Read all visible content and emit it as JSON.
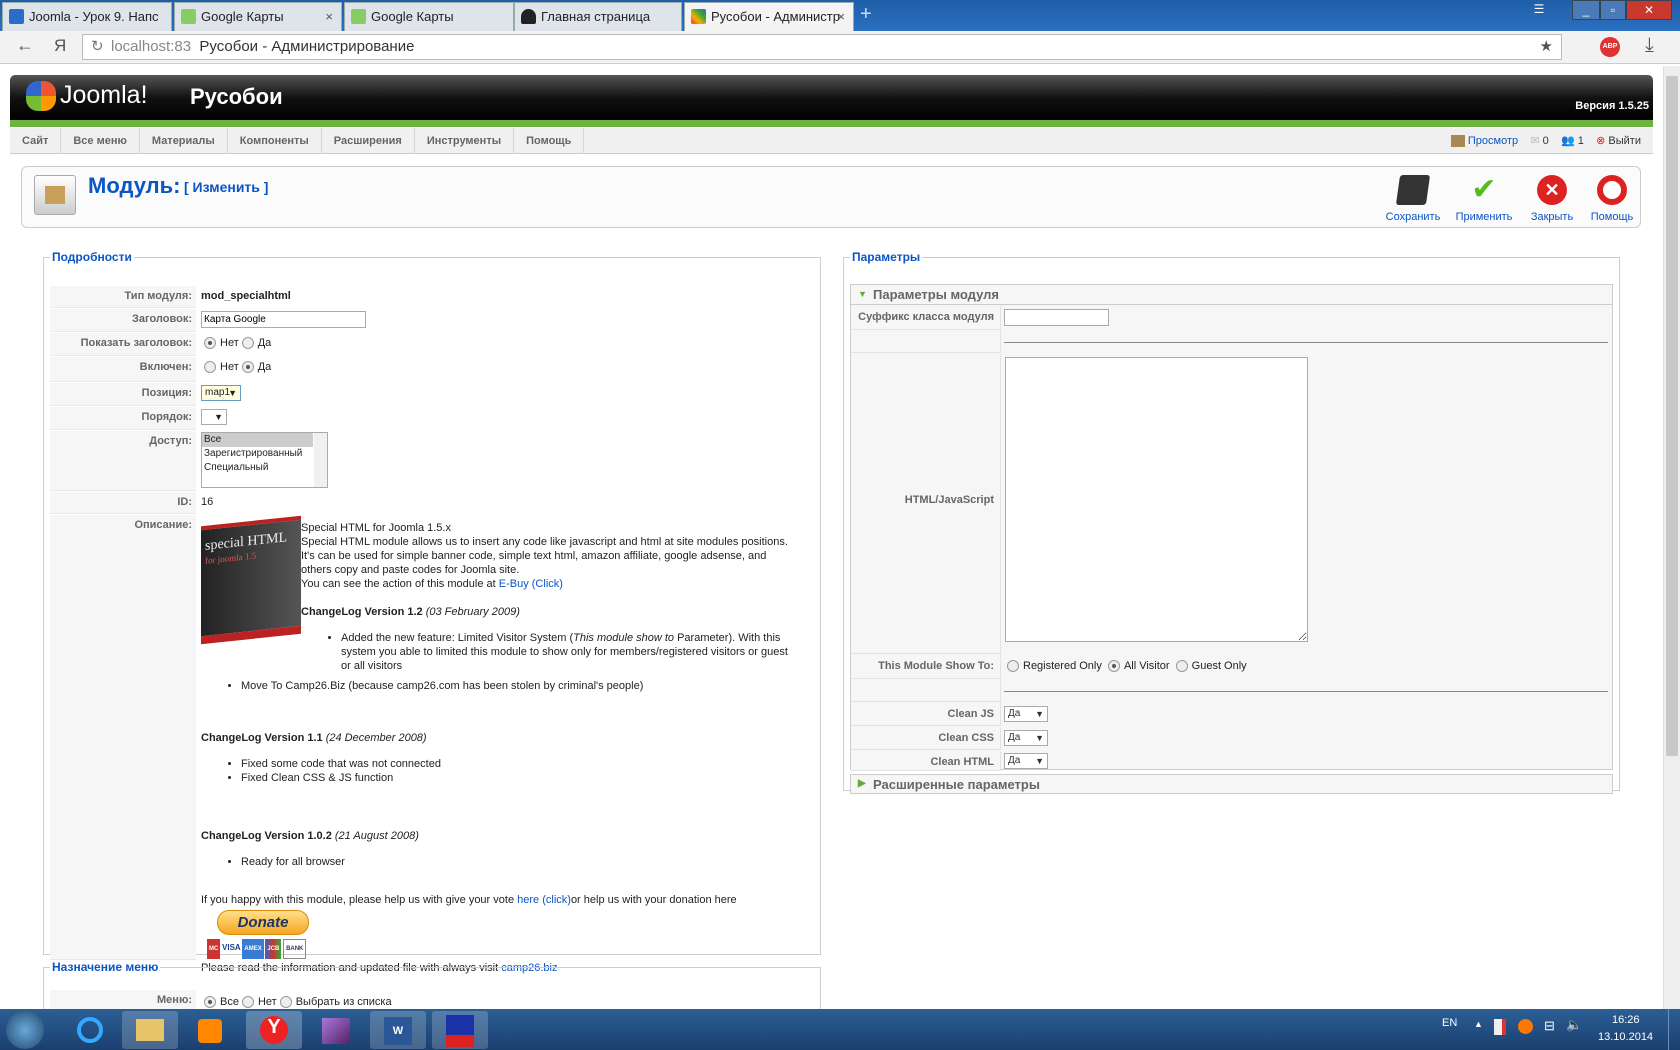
{
  "browser": {
    "tabs": [
      {
        "title": "Joomla - Урок 9. Напс",
        "icon": "site-icon"
      },
      {
        "title": "Google Карты",
        "icon": "maps-icon"
      },
      {
        "title": "Google Карты",
        "icon": "maps-icon"
      },
      {
        "title": "Главная страница",
        "icon": "spy-icon"
      },
      {
        "title": "Русобои - Администр",
        "icon": "joomla-icon"
      }
    ],
    "close": "×",
    "new_tab": "+",
    "back": "←",
    "yandex": "Я",
    "reload": "↻",
    "url_host": "localhost:83",
    "url_title": "Русобои - Администрирование",
    "star": "★",
    "abp": "ABP",
    "download": "⤓"
  },
  "header": {
    "logo": "Joomla!",
    "site": "Русобои",
    "version": "Версия 1.5.25"
  },
  "menu": [
    "Сайт",
    "Все меню",
    "Материалы",
    "Компоненты",
    "Расширения",
    "Инструменты",
    "Помощь"
  ],
  "status": {
    "preview": "Просмотр",
    "messages": "0",
    "users": "1",
    "logout": "Выйти"
  },
  "page": {
    "title": "Модуль:",
    "subtitle": "[ Изменить ]"
  },
  "toolbar": {
    "save": "Сохранить",
    "apply": "Применить",
    "close": "Закрыть",
    "help": "Помощь"
  },
  "details": {
    "legend": "Подробности",
    "type_label": "Тип модуля:",
    "type_value": "mod_specialhtml",
    "title_label": "Заголовок:",
    "title_value": "Карта Google",
    "show_title_label": "Показать заголовок:",
    "no": "Нет",
    "yes": "Да",
    "enabled_label": "Включен:",
    "position_label": "Позиция:",
    "position_value": "map1",
    "order_label": "Порядок:",
    "access_label": "Доступ:",
    "access_options": [
      "Все",
      "Зарегистрированный",
      "Специальный"
    ],
    "id_label": "ID:",
    "id_value": "16",
    "desc_label": "Описание:"
  },
  "description": {
    "box_text": "special HTML",
    "box_sub": "for joomla 1.5",
    "l1": "Special HTML for Joomla 1.5.x",
    "l2": "Special HTML module allows us to insert any code like javascript and html at site modules positions. It's can be used for simple banner code, simple text html, amazon affiliate, google adsense, and others copy and paste codes for Joomla site.",
    "l3": "You can see the action of this module at ",
    "ebuy": "E-Buy",
    "click": "(Click)",
    "v12": "ChangeLog Version 1.2",
    "v12_date": "(03 February 2009)",
    "v12_a1": "Added the new feature: Limited Visitor System (",
    "v12_a2": "This module show to",
    "v12_a3": " Parameter). With this system you able to limited this module to show only for members/registered visitors or guest or all visitors",
    "v12_b": "Move To Camp26.Biz (because camp26.com has been stolen by criminal's people)",
    "v11": "ChangeLog Version 1.1",
    "v11_date": "(24 December 2008)",
    "v11_a": "Fixed some code that was not connected",
    "v11_b": "Fixed Clean CSS & JS function",
    "v102": "ChangeLog Version 1.0.2",
    "v102_date": "(21 August 2008)",
    "v102_a": "Ready for all browser",
    "vote1": "If you happy with this module, please help us with give your vote ",
    "here": "here",
    "click2": "(click)",
    "vote2": "or help us with your donation here",
    "donate": "Donate",
    "cards": [
      "MC",
      "VISA",
      "AMEX",
      "JCB",
      "BANK"
    ],
    "read": "Please read the information and updated file with always visit ",
    "camp": "camp26.biz"
  },
  "params": {
    "legend": "Параметры",
    "section": "Параметры модуля",
    "suffix_label": "Суффикс класса модуля",
    "html_label": "HTML/JavaScript",
    "show_to_label": "This Module Show To:",
    "show_to": [
      "Registered Only",
      "All Visitor",
      "Guest Only"
    ],
    "clean_js": "Clean JS",
    "clean_css": "Clean CSS",
    "clean_html": "Clean HTML",
    "yes": "Да",
    "advanced": "Расширенные параметры"
  },
  "menu_assign": {
    "legend": "Назначение меню",
    "label": "Меню:",
    "options": [
      "Все",
      "Нет",
      "Выбрать из списка"
    ]
  },
  "taskbar": {
    "lang": "EN",
    "time": "16:26",
    "date": "13.10.2014"
  }
}
